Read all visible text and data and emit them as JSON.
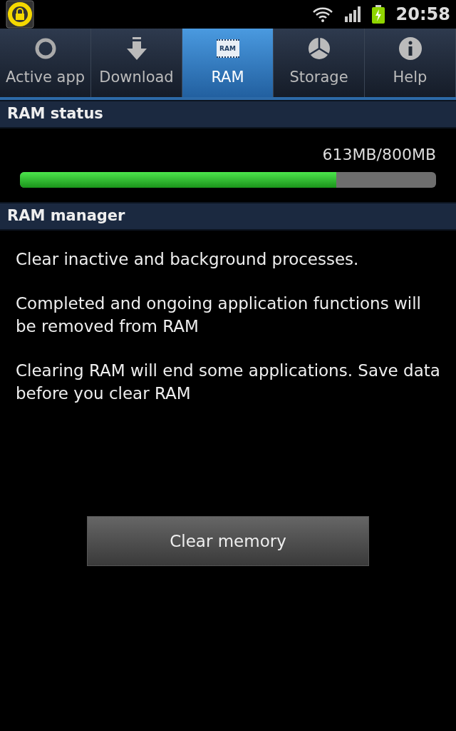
{
  "status_bar": {
    "time": "20:58"
  },
  "tabs": [
    {
      "label": "Active app",
      "kind": "ring",
      "selected": false
    },
    {
      "label": "Download",
      "kind": "download",
      "selected": false
    },
    {
      "label": "RAM",
      "kind": "chip",
      "chip_text": "RAM",
      "selected": true
    },
    {
      "label": "Storage",
      "kind": "pie",
      "selected": false
    },
    {
      "label": "Help",
      "kind": "info",
      "selected": false
    }
  ],
  "ram_status": {
    "header": "RAM status",
    "reading": "613MB/800MB",
    "level": 0.76
  },
  "ram_manager": {
    "header": "RAM manager",
    "paragraphs": [
      "Clear inactive and background processes.",
      "Completed and ongoing application functions will be removed from RAM",
      "Clearing RAM will end some applications. Save data before you clear RAM"
    ],
    "button": "Clear memory"
  }
}
